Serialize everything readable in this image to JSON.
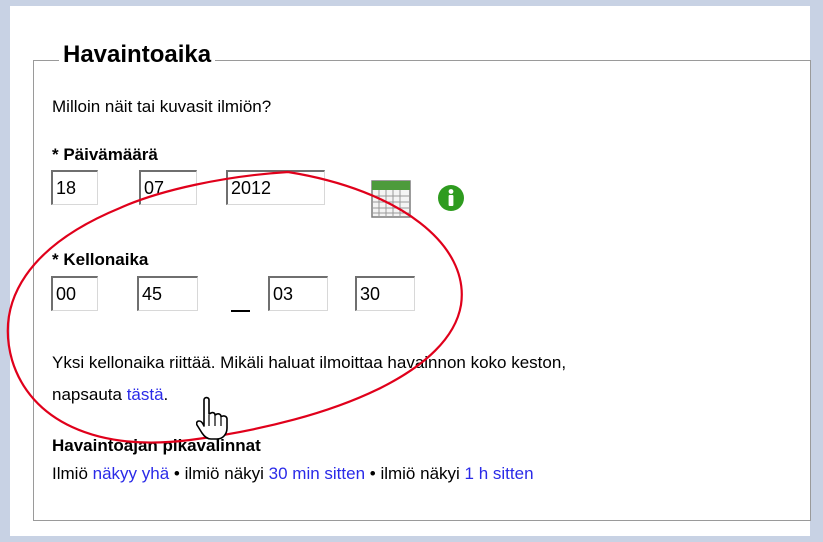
{
  "section": {
    "legend": "Havaintoaika",
    "question": "Milloin näit tai kuvasit ilmiön?"
  },
  "date": {
    "label": "* Päivämäärä",
    "day": "18",
    "month": "07",
    "year": "2012",
    "calendar_icon": "calendar-icon",
    "info_icon": "info-icon"
  },
  "time": {
    "label": "* Kellonaika",
    "start_hour": "00",
    "start_minute": "45",
    "end_hour": "03",
    "end_minute": "30"
  },
  "hint": {
    "line1": "Yksi kellonaika riittää. Mikäli haluat ilmoittaa havainnon koko keston,",
    "line2_prefix": "napsauta ",
    "link": "tästä",
    "line2_suffix": "."
  },
  "shortcuts": {
    "title": "Havaintoajan pikavalinnat",
    "p1": "Ilmiö ",
    "l1": "näkyy yhä",
    "p2": " • ilmiö näkyi ",
    "l2": "30 min sitten",
    "p3": " • ilmiö näkyi ",
    "l3": "1 h sitten"
  },
  "colors": {
    "background": "#c8d2e4",
    "link": "#2a2ae8",
    "annotation": "#e0001b",
    "info_green": "#2e9b1f"
  }
}
